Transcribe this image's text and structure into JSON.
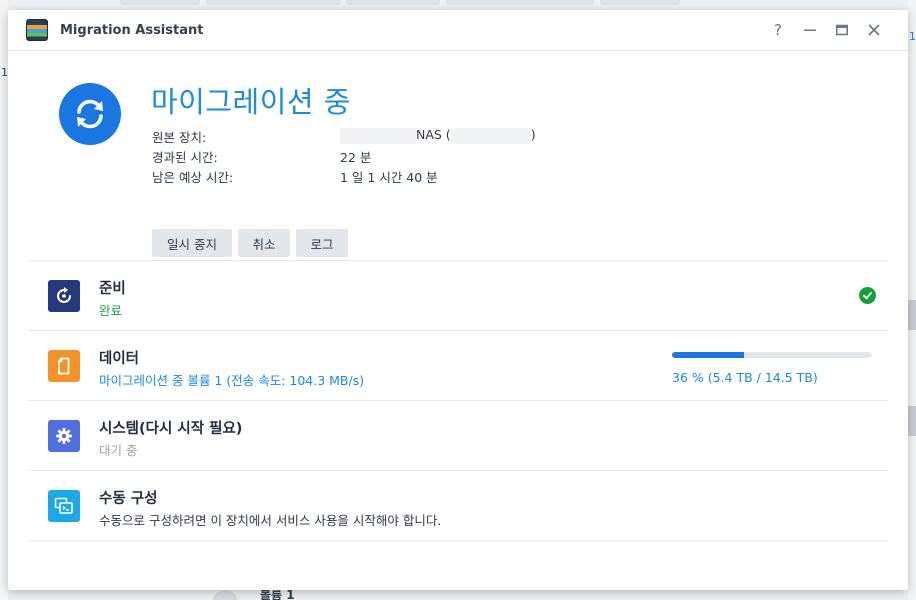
{
  "window": {
    "title": "Migration Assistant",
    "controls": {
      "help": "?",
      "minimize": "—",
      "maximize": "▭",
      "close": "✕"
    }
  },
  "status": {
    "heading": "마이그레이션 중",
    "icon": "sync-icon",
    "color": "#1a76e0"
  },
  "info": {
    "source_label": "원본 장치:",
    "source_value": "NAS (",
    "source_value_end": ")",
    "elapsed_label": "경과된 시간:",
    "elapsed_value": "22 분",
    "remaining_label": "남은 예상 시간:",
    "remaining_value": "1 일 1 시간 40 분"
  },
  "actions": {
    "pause": "일시 중지",
    "cancel": "취소",
    "log": "로그"
  },
  "steps": [
    {
      "title": "준비",
      "subtitle": "완료",
      "icon": "restart-icon",
      "color": "#25397e",
      "state": "done"
    },
    {
      "title": "데이터",
      "subtitle": "마이그레이션 중 볼륨 1 (전송 속도: 104.3 MB/s)",
      "icon": "file-icon",
      "color": "#f39327",
      "state": "in-progress",
      "progress_percent": 36,
      "progress_text": "36 % (5.4 TB / 14.5 TB)"
    },
    {
      "title": "시스템(다시 시작 필요)",
      "subtitle": "대기 중",
      "icon": "gear-icon",
      "color": "#4f6fe0",
      "state": "waiting"
    },
    {
      "title": "수동 구성",
      "subtitle": "수동으로 구성하려면 이 장치에서 서비스 사용을 시작해야 합니다.",
      "icon": "console-icon",
      "color": "#1aa8e8",
      "state": "info"
    }
  ],
  "background": {
    "left_number": "1",
    "right_number": "1",
    "bottom_text": "볼륨 1"
  }
}
